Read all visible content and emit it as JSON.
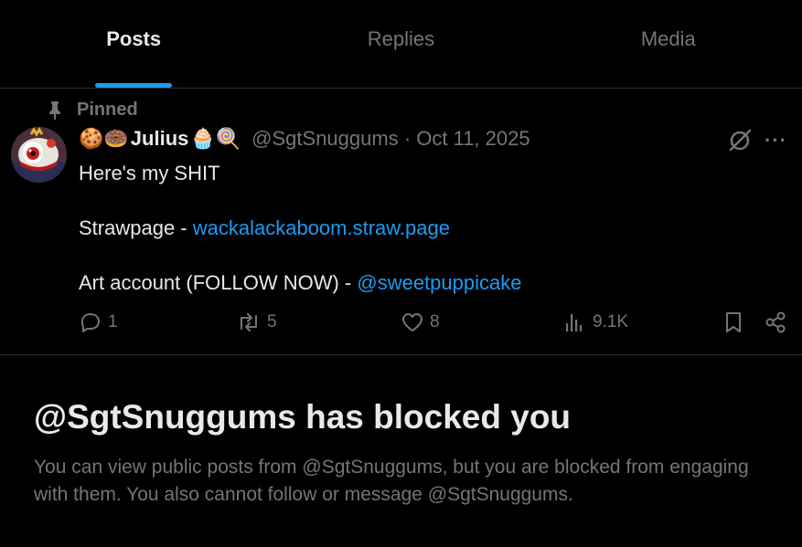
{
  "tabs": [
    {
      "label": "Posts",
      "active": true
    },
    {
      "label": "Replies",
      "active": false
    },
    {
      "label": "Media",
      "active": false
    }
  ],
  "accent_color": "#1d9bf0",
  "post": {
    "pinned_label": "Pinned",
    "name_prefix_emoji": "🍪🍩",
    "display_name": "Julius",
    "name_suffix_emoji": "🧁🍭",
    "handle_meta": "@SgtSnuggums · Oct 11, 2025",
    "more_label": "···",
    "line1": "Here's my SHIT",
    "line2_prefix": "Strawpage - ",
    "line2_link": "wackalackaboom.straw.page",
    "line3_prefix": "Art account (FOLLOW NOW) - ",
    "line3_link": "@sweetpuppicake",
    "stats": {
      "replies": "1",
      "reposts": "5",
      "likes": "8",
      "views": "9.1K"
    },
    "icons": [
      "pin-icon",
      "grok-icon",
      "more-icon",
      "reply-icon",
      "repost-icon",
      "like-icon",
      "views-icon",
      "bookmark-icon",
      "share-icon"
    ]
  },
  "blocked": {
    "title": "@SgtSnuggums has blocked you",
    "description": "You can view public posts from @SgtSnuggums, but you are blocked from engaging with them. You also cannot follow or message @SgtSnuggums."
  }
}
